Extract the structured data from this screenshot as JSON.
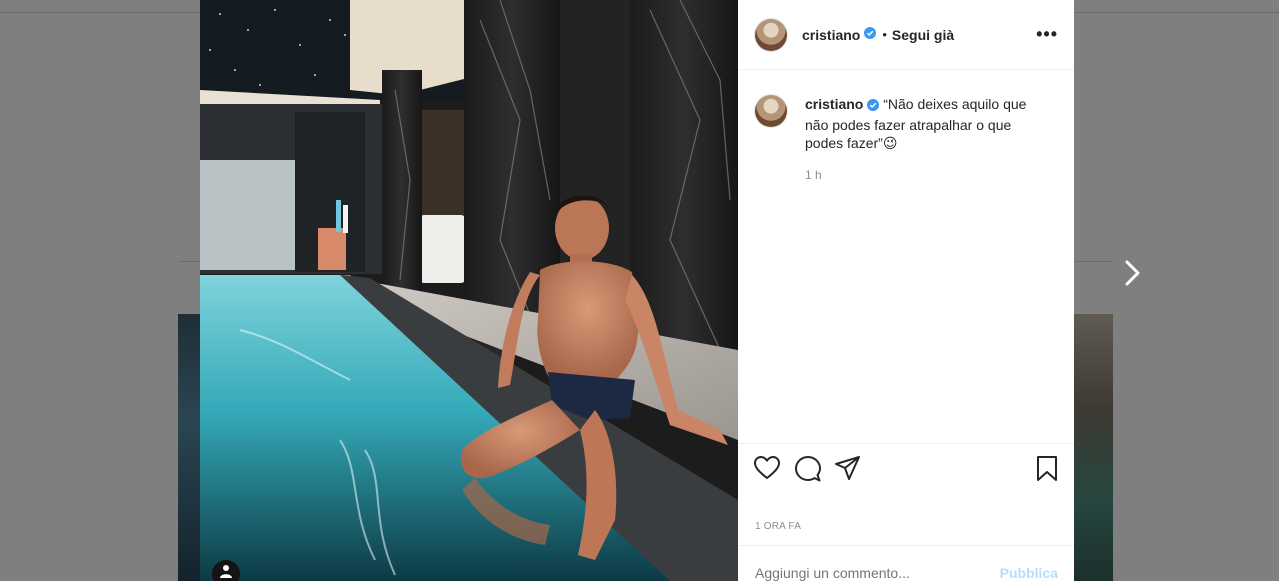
{
  "post": {
    "username": "cristiano",
    "follow_status": "Segui già",
    "more_icon": "more-options-icon",
    "caption": "“Não deixes aquilo que não podes fazer atrapalhar o que podes fazer”",
    "caption_emoji": "😉",
    "relative_time": "1 h",
    "date_label": "1 ORA FA",
    "comment_placeholder": "Aggiungi un commento...",
    "publish_label": "Pubblica"
  },
  "colors": {
    "verified": "#3897f0",
    "publish_disabled": "#b2dffc",
    "text": "#262626",
    "muted": "#8e8e8e"
  },
  "icons": [
    "heart-icon",
    "comment-icon",
    "share-icon",
    "bookmark-icon",
    "verified-badge-icon",
    "next-arrow-icon",
    "user-tag-icon"
  ]
}
